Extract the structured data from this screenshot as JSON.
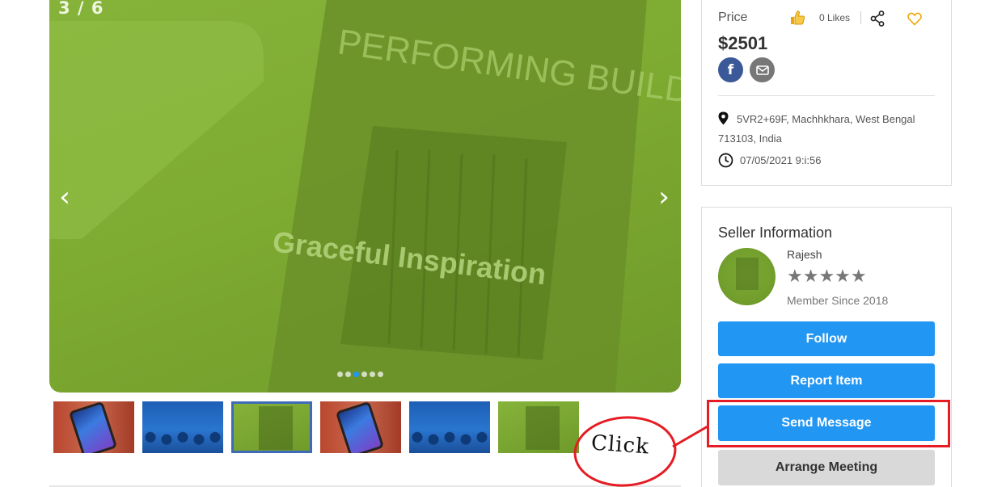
{
  "gallery": {
    "slide_counter": "3 / 6",
    "prev_arrow": "‹",
    "next_arrow": "›",
    "dot_count": 6,
    "active_dot": 2,
    "book_title": "PERFORMING BUILDINGS",
    "book_subtitle": "Graceful Inspiration",
    "thumbnails": [
      "phone",
      "team",
      "book",
      "phone",
      "team",
      "book"
    ],
    "active_thumbnail": 2
  },
  "listing": {
    "price_label": "Price",
    "likes_text": "0 Likes",
    "price": "$2501",
    "facebook_label": "f",
    "address": "5VR2+69F, Machhkhara, West Bengal 713103, India",
    "datetime": "07/05/2021 9:i:56"
  },
  "seller": {
    "title": "Seller Information",
    "name": "Rajesh",
    "stars": "★★★★★",
    "member_since": "Member Since 2018",
    "buttons": {
      "follow": "Follow",
      "report": "Report Item",
      "message": "Send Message",
      "meeting": "Arrange Meeting"
    }
  },
  "annotation": {
    "text": "Click",
    "color": "#e51c23"
  },
  "colors": {
    "accent": "#2196f3",
    "image_tint": "#7eab31",
    "facebook": "#3b5998",
    "heart": "#f0a500"
  }
}
